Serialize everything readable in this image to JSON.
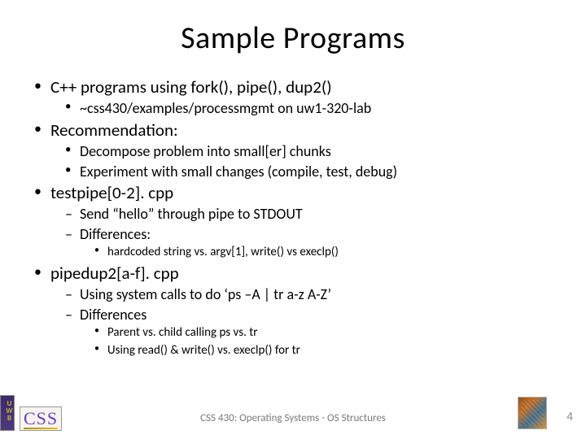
{
  "title": "Sample Programs",
  "bullets": {
    "i0": "C++ programs using fork(), pipe(), dup2()",
    "i0a": "~css430/examples/processmgmt on uw1-320-lab",
    "i1": "Recommendation:",
    "i1a": "Decompose problem into small[er] chunks",
    "i1b": "Experiment with small changes (compile, test, debug)",
    "i2": "testpipe[0-2]. cpp",
    "i2a": "Send “hello” through pipe to STDOUT",
    "i2b": "Differences:",
    "i2b1": "hardcoded string vs. argv[1], write() vs execlp()",
    "i3": "pipedup2[a-f]. cpp",
    "i3a": "Using system calls to do ‘ps –A | tr a-z A-Z’",
    "i3b": "Differences",
    "i3b1": "Parent vs. child calling ps vs. tr",
    "i3b2": "Using read() & write() vs. execlp() for tr"
  },
  "footer": {
    "text": "CSS 430: Operating Systems - OS Structures",
    "page": "4",
    "css_logo": "CSS"
  }
}
